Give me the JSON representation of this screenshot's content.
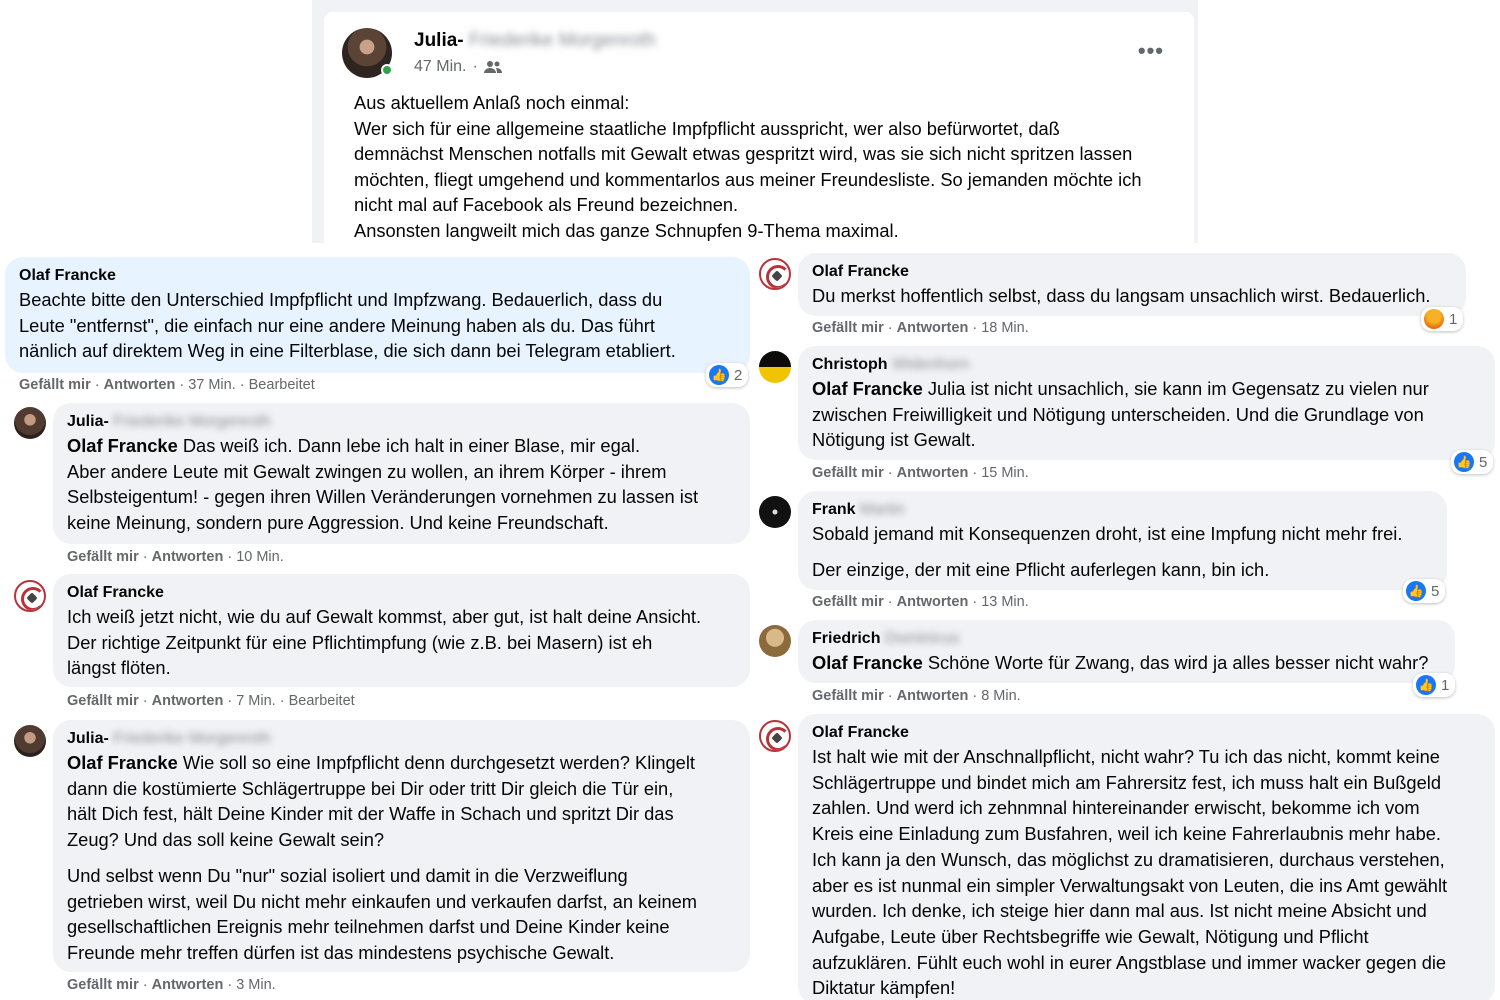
{
  "post": {
    "author_first": "Julia-",
    "author_rest": "Friederike Morgenroth",
    "time": "47 Min.",
    "audience_icon": "friends-icon",
    "more_icon": "more-options-icon",
    "more_label": "•••",
    "lines": [
      "Aus aktuellem Anlaß noch einmal:",
      "Wer sich für eine allgemeine staatliche Impfpflicht ausspricht, wer also befürwortet, daß",
      "demnächst Menschen notfalls mit Gewalt etwas gespritzt wird, was sie sich nicht spritzen lassen",
      "möchten, fliegt umgehend und kommentarlos aus meiner Freundesliste. So jemanden möchte ich",
      "nicht mal auf Facebook als Freund bezeichnen.",
      "Ansonsten langweilt mich das ganze Schnupfen 9-Thema maximal."
    ]
  },
  "labels": {
    "like": "Gefällt mir",
    "reply": "Antworten",
    "dot": " · ",
    "edited": "Bearbeitet"
  },
  "comments": {
    "c1": {
      "name": "Olaf Francke",
      "lines": [
        "Beachte bitte den Unterschied Impfpflicht und Impfzwang. Bedauerlich, dass du",
        "Leute \"entfernst\", die einfach nur eine andere Meinung haben als du. Das führt",
        "nänlich auf direktem Weg in eine Filterblase, die sich dann bei Telegram etabliert."
      ],
      "time": "37 Min.",
      "reaction_count": "2"
    },
    "c2": {
      "name_first": "Julia-",
      "name_rest": "Friederike Morgenroth",
      "tag": "Olaf Francke",
      "first_line_rest": " Das weiß ich. Dann lebe ich halt in einer Blase, mir egal.",
      "lines": [
        "Aber andere Leute mit Gewalt zwingen zu wollen, an ihrem Körper - ihrem",
        "Selbsteigentum! - gegen ihren Willen Veränderungen vornehmen zu lassen ist",
        "keine Meinung, sondern pure Aggression. Und keine Freundschaft."
      ],
      "time": "10 Min."
    },
    "c3": {
      "name": "Olaf Francke",
      "lines": [
        "Ich weiß jetzt nicht, wie du auf Gewalt kommst, aber gut, ist halt deine Ansicht.",
        "Der richtige Zeitpunkt für eine Pflichtimpfung (wie z.B. bei Masern) ist eh",
        "längst flöten."
      ],
      "time": "7 Min."
    },
    "c4": {
      "name_first": "Julia-",
      "name_rest": "Friederike Morgenroth",
      "tag": "Olaf Francke",
      "first_line_rest": " Wie soll so eine Impfpflicht denn durchgesetzt werden? Klingelt",
      "lines": [
        "dann die kostümierte Schlägertruppe bei Dir oder tritt Dir gleich die Tür ein,",
        "hält Dich fest, hält Deine Kinder mit der Waffe in Schach und spritzt Dir das",
        "Zeug? Und das soll keine Gewalt sein?"
      ],
      "lines2": [
        "Und selbst wenn Du \"nur\" sozial isoliert und damit in die Verzweiflung",
        "getrieben wirst, weil Du nicht mehr einkaufen und verkaufen darfst, an keinem",
        "gesellschaftlichen Ereignis mehr teilnehmen darfst und Deine Kinder keine",
        "Freunde mehr treffen dürfen ist das mindestens psychische Gewalt."
      ],
      "time": "3 Min."
    },
    "c5": {
      "name": "Olaf Francke",
      "lines": [
        "Du merkst hoffentlich selbst, dass du langsam unsachlich wirst. Bedauerlich."
      ],
      "time": "18 Min.",
      "reaction_count": "1"
    },
    "c6": {
      "name_first": "Christoph",
      "name_rest": "Widenhorn",
      "tag": "Olaf Francke",
      "first_line_rest": " Julia ist nicht unsachlich, sie kann im Gegensatz zu vielen nur",
      "lines": [
        "zwischen Freiwilligkeit und Nötigung unterscheiden. Und die Grundlage von",
        "Nötigung ist Gewalt."
      ],
      "time": "15 Min.",
      "reaction_count": "5"
    },
    "c7": {
      "name_first": "Frank",
      "name_rest": "Martin",
      "lines": [
        "Sobald jemand mit Konsequenzen droht, ist eine Impfung nicht mehr frei."
      ],
      "lines2": [
        "Der einzige, der mit eine Pflicht auferlegen kann, bin ich."
      ],
      "time": "13 Min.",
      "reaction_count": "5"
    },
    "c8": {
      "name_first": "Friedrich",
      "name_rest": "Dominicus",
      "tag": "Olaf Francke",
      "first_line_rest": " Schöne Worte für Zwang, das wird ja alles besser nicht wahr?",
      "time": "8 Min.",
      "reaction_count": "1"
    },
    "c9": {
      "name": "Olaf Francke",
      "lines": [
        "Ist halt wie mit der Anschnallpflicht, nicht wahr? Tu ich das nicht, kommt keine",
        "Schlägertruppe und bindet mich am Fahrersitz fest, ich muss halt ein Bußgeld",
        "zahlen. Und werd ich zehnmnal hintereinander erwischt, bekomme ich vom",
        "Kreis eine Einladung zum Busfahren, weil ich keine Fahrerlaubnis mehr habe.",
        "Ich kann ja den Wunsch, das möglichst zu dramatisieren, durchaus verstehen,",
        "aber es ist nunmal ein simpler Verwaltungsakt von Leuten, die ins Amt gewählt",
        "wurden. Ich denke, ich steige hier dann mal aus. Ist nicht meine Absicht und",
        "Aufgabe, Leute über Rechtsbegriffe wie Gewalt, Nötigung und Pflicht",
        "aufzuklären. Fühlt euch wohl in eurer Angstblase und immer wacker gegen die",
        "Diktatur kämpfen!"
      ]
    }
  }
}
